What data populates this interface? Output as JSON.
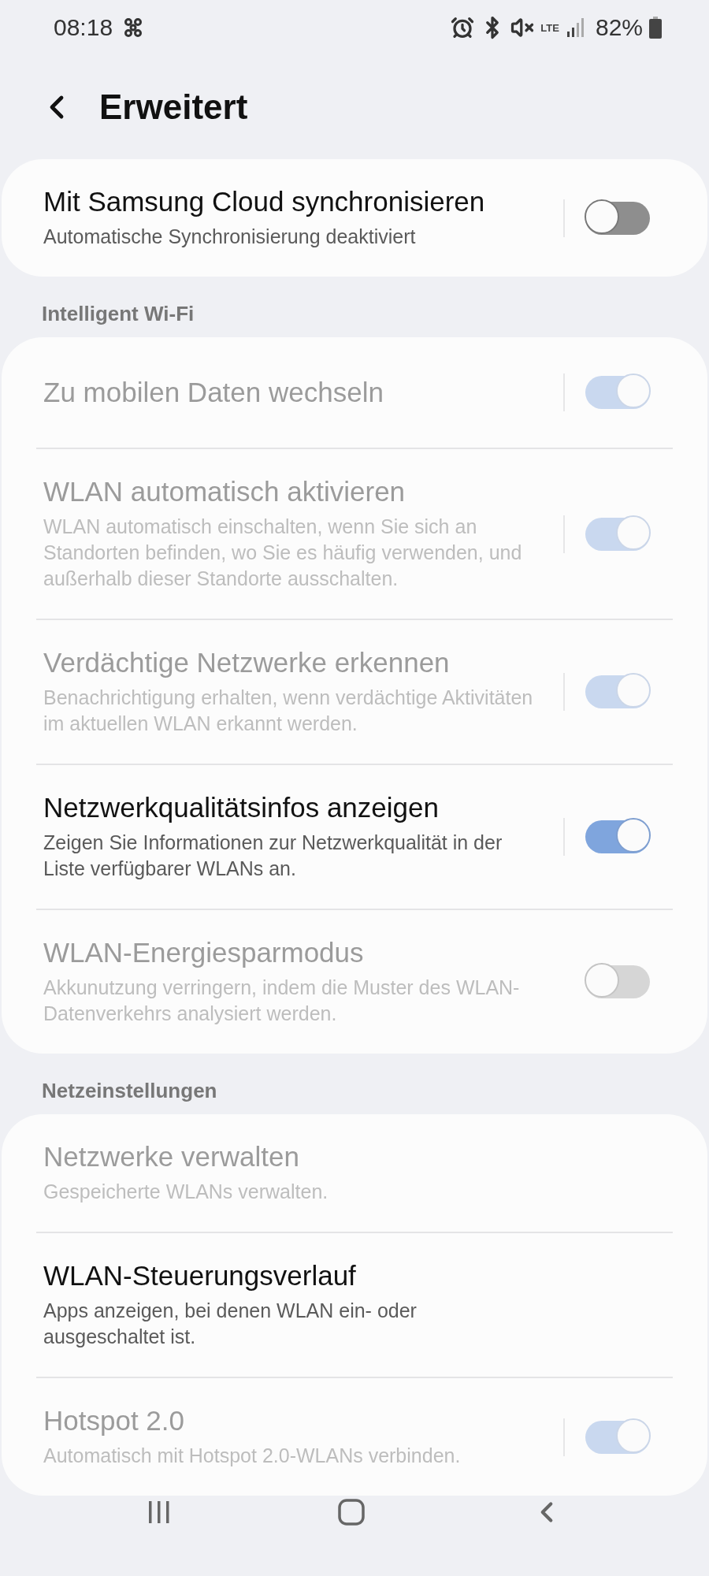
{
  "status_bar": {
    "time": "08:18",
    "network": "LTE",
    "battery": "82%"
  },
  "header": {
    "title": "Erweitert"
  },
  "sections": [
    {
      "items": [
        {
          "title": "Mit Samsung Cloud synchronisieren",
          "subtitle": "Automatische Synchronisierung deaktiviert",
          "disabled": false,
          "has_detail": true,
          "on": false
        }
      ]
    },
    {
      "label": "Intelligent Wi-Fi",
      "items": [
        {
          "title": "Zu mobilen Daten wechseln",
          "disabled": true,
          "has_detail": true,
          "on": true
        },
        {
          "title": "WLAN automatisch aktivieren",
          "subtitle": "WLAN automatisch einschalten, wenn Sie sich an Standorten befinden, wo Sie es häufig verwenden, und außerhalb dieser Standorte ausschalten.",
          "disabled": true,
          "has_detail": true,
          "on": true
        },
        {
          "title": "Verdächtige Netzwerke erkennen",
          "subtitle": "Benachrichtigung erhalten, wenn verdächtige Aktivitäten im aktuellen WLAN erkannt werden.",
          "disabled": true,
          "has_detail": true,
          "on": true
        },
        {
          "title": "Netzwerkqualitätsinfos anzeigen",
          "subtitle": "Zeigen Sie Informationen zur Netzwerkqualität in der Liste verfügbarer WLANs an.",
          "disabled": false,
          "has_detail": true,
          "on": true
        },
        {
          "title": "WLAN-Energiesparmodus",
          "subtitle": "Akkunutzung verringern, indem die Muster des WLAN-Datenverkehrs analysiert werden.",
          "disabled": true,
          "has_detail": false,
          "on": false
        }
      ]
    },
    {
      "label": "Netzeinstellungen",
      "items": [
        {
          "title": "Netzwerke verwalten",
          "subtitle": "Gespeicherte WLANs verwalten.",
          "disabled": true,
          "has_detail": false
        },
        {
          "title": "WLAN-Steuerungsverlauf",
          "subtitle": "Apps anzeigen, bei denen WLAN ein- oder ausgeschaltet ist.",
          "disabled": false,
          "has_detail": false
        },
        {
          "title": "Hotspot 2.0",
          "subtitle": "Automatisch mit Hotspot 2.0-WLANs verbinden.",
          "disabled": true,
          "has_detail": true,
          "on": true
        }
      ]
    }
  ]
}
